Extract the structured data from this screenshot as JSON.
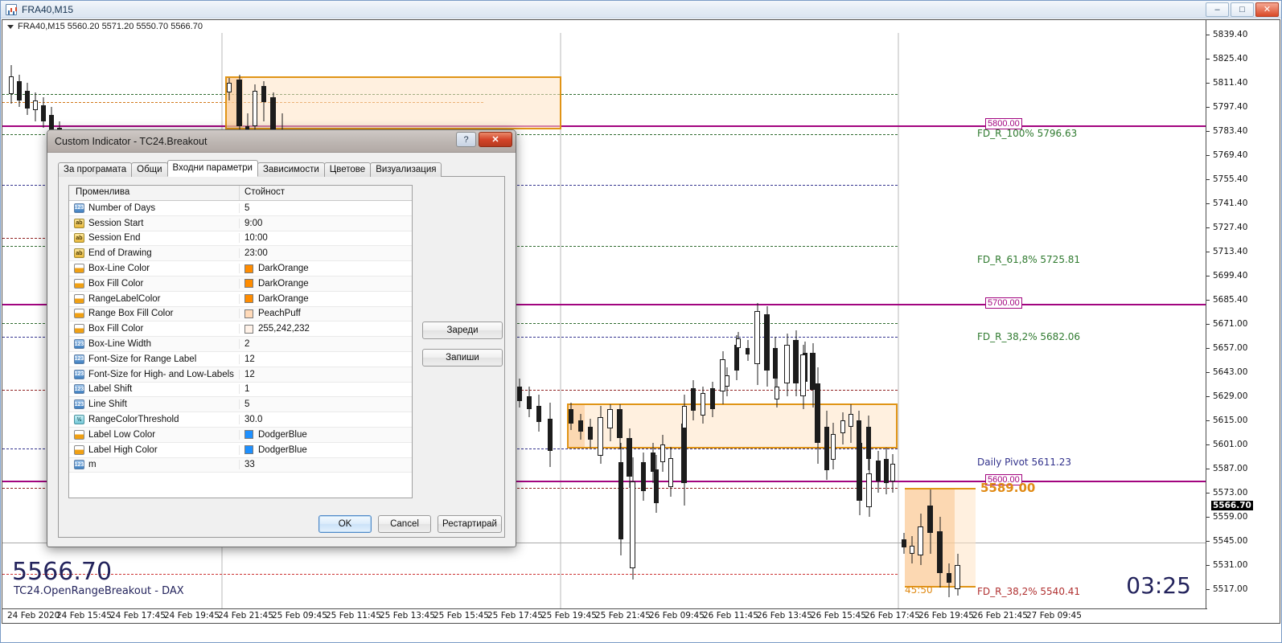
{
  "window": {
    "title": "FRA40,M15",
    "icon": "chart-window-icon",
    "controls": {
      "minimize": "–",
      "maximize": "□",
      "close": "✕"
    }
  },
  "chart": {
    "header": "FRA40,M15  5560.20 5571.20 5550.70 5566.70",
    "symbol": "FRA40",
    "timeframe": "M15",
    "ohlc": {
      "open": "5560.20",
      "high": "5571.20",
      "low": "5550.70",
      "close": "5566.70"
    },
    "last_price_big": "5566.70",
    "indicator_caption": "TC24.OpenRangeBreakout - DAX",
    "clock": "03:25",
    "current_price_tag": "5566.70",
    "range_duration_label": "45:50",
    "range_high_label": "5589.00",
    "price_ticks": [
      "5839.40",
      "5825.40",
      "5811.40",
      "5797.40",
      "5783.40",
      "5769.40",
      "5755.40",
      "5741.40",
      "5727.40",
      "5713.40",
      "5699.40",
      "5685.40",
      "5671.00",
      "5657.00",
      "5643.00",
      "5629.00",
      "5615.00",
      "5601.00",
      "5587.00",
      "5573.00",
      "5559.00",
      "5545.00",
      "5531.00",
      "5517.00"
    ],
    "time_ticks": [
      "24 Feb 2020",
      "24 Feb 15:45",
      "24 Feb 17:45",
      "24 Feb 19:45",
      "24 Feb 21:45",
      "25 Feb 09:45",
      "25 Feb 11:45",
      "25 Feb 13:45",
      "25 Feb 15:45",
      "25 Feb 17:45",
      "25 Feb 19:45",
      "25 Feb 21:45",
      "26 Feb 09:45",
      "26 Feb 11:45",
      "26 Feb 13:45",
      "26 Feb 15:45",
      "26 Feb 17:45",
      "26 Feb 19:45",
      "26 Feb 21:45",
      "27 Feb 09:45"
    ],
    "annotations": [
      {
        "text": "FD_R_100% 5796.63",
        "color": "#2f7a2f"
      },
      {
        "text": "FD_R_61,8% 5725.81",
        "color": "#2f7a2f"
      },
      {
        "text": "FD_R_38,2% 5682.06",
        "color": "#2f7a2f"
      },
      {
        "text": "Daily Pivot 5611.23",
        "color": "#32328c"
      },
      {
        "text": "FD_R_38,2% 5540.41",
        "color": "#b03030"
      }
    ],
    "price_tags": [
      "5800.00",
      "5700.00",
      "5600.00"
    ],
    "colors": {
      "magenta_line": "#a2047f",
      "box_border": "#e09416",
      "box_fill": "#ffe4c4",
      "green_label": "#2f7a2f",
      "navy_label": "#32328c",
      "red_label": "#b03030",
      "orange_label": "#e08a14"
    }
  },
  "dialog": {
    "title": "Custom Indicator - TC24.Breakout",
    "help_glyph": "?",
    "close_glyph": "✕",
    "tabs": [
      {
        "label": "За програмата",
        "active": false
      },
      {
        "label": "Общи",
        "active": false
      },
      {
        "label": "Входни параметри",
        "active": true
      },
      {
        "label": "Зависимости",
        "active": false
      },
      {
        "label": "Цветове",
        "active": false
      },
      {
        "label": "Визуализация",
        "active": false
      }
    ],
    "grid": {
      "header": {
        "variable": "Променлива",
        "value": "Стойност"
      },
      "rows": [
        {
          "icon": "number-icon",
          "type": "num",
          "name": "Number of Days",
          "value": "5"
        },
        {
          "icon": "string-icon",
          "type": "str",
          "name": "Session Start",
          "value": "9:00"
        },
        {
          "icon": "string-icon",
          "type": "str",
          "name": "Session End",
          "value": "10:00"
        },
        {
          "icon": "string-icon",
          "type": "str",
          "name": "End of Drawing",
          "value": "23:00"
        },
        {
          "icon": "color-icon",
          "type": "col",
          "name": "Box-Line Color",
          "value": "DarkOrange",
          "swatch": "#ff8c00"
        },
        {
          "icon": "color-icon",
          "type": "col",
          "name": "Box Fill Color",
          "value": "DarkOrange",
          "swatch": "#ff8c00"
        },
        {
          "icon": "color-icon",
          "type": "col",
          "name": "RangeLabelColor",
          "value": "DarkOrange",
          "swatch": "#ff8c00"
        },
        {
          "icon": "color-icon",
          "type": "col",
          "name": "Range Box Fill Color",
          "value": "PeachPuff",
          "swatch": "#ffdab9"
        },
        {
          "icon": "color-icon",
          "type": "col",
          "name": "Box Fill Color",
          "value": "255,242,232",
          "swatch": "#fff2e8"
        },
        {
          "icon": "number-icon",
          "type": "num",
          "name": "Box-Line Width",
          "value": "2"
        },
        {
          "icon": "number-icon",
          "type": "num",
          "name": "Font-Size for Range Label",
          "value": "12"
        },
        {
          "icon": "number-icon",
          "type": "num",
          "name": "Font-Size for High- and Low-Labels",
          "value": "12"
        },
        {
          "icon": "number-icon",
          "type": "num",
          "name": "Label Shift",
          "value": "1"
        },
        {
          "icon": "number-icon",
          "type": "num",
          "name": "Line Shift",
          "value": "5"
        },
        {
          "icon": "double-icon",
          "type": "dbl",
          "name": "RangeColorThreshold",
          "value": "30.0"
        },
        {
          "icon": "color-icon",
          "type": "col",
          "name": "Label Low Color",
          "value": "DodgerBlue",
          "swatch": "#1e90ff"
        },
        {
          "icon": "color-icon",
          "type": "col",
          "name": "Label High Color",
          "value": "DodgerBlue",
          "swatch": "#1e90ff"
        },
        {
          "icon": "number-icon",
          "type": "num",
          "name": "m",
          "value": "33"
        }
      ]
    },
    "side_buttons": [
      {
        "label": "Зареди",
        "name": "load-button"
      },
      {
        "label": "Запиши",
        "name": "save-button"
      }
    ],
    "bottom_buttons": [
      {
        "label": "OK",
        "name": "ok-button",
        "primary": true
      },
      {
        "label": "Cancel",
        "name": "cancel-button",
        "primary": false
      },
      {
        "label": "Рестартирай",
        "name": "restart-button",
        "primary": false,
        "wide": true
      }
    ]
  }
}
